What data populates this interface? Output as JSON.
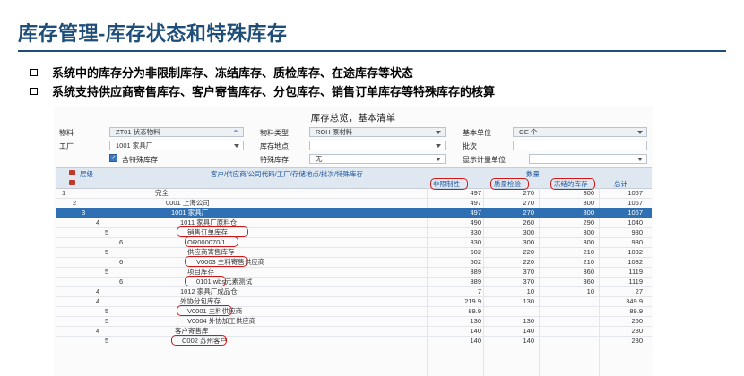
{
  "slide": {
    "title": "库存管理-库存状态和特殊库存",
    "bullets": [
      "系统中的库存分为非限制库存、冻结库存、质检库存、在途库存等状态",
      "系统支持供应商寄售库存、客户寄售库存、分包库存、销售订单库存等特殊库存的核算"
    ]
  },
  "screen": {
    "title": "库存总览，基本清单",
    "fields": {
      "material_label": "物料",
      "material_value": "ZT01 状态物料",
      "material_type_label": "物料类型",
      "material_type_value": "ROH 原材料",
      "base_unit_label": "基本单位",
      "base_unit_value": "GE 个",
      "plant_label": "工厂",
      "plant_value": "1001 家具厂",
      "storage_loc_label": "库存地点",
      "batch_label": "批次",
      "special_stock_checkbox_label": "含特殊库存",
      "special_stock_label": "特殊库存",
      "special_stock_value": "无",
      "display_unit_label": "显示计量单位"
    },
    "grid": {
      "header_left": "层级",
      "header_desc": "客户/供应商/公司代码/工厂/存储地点/批次/特殊库存",
      "header_qty": "数量",
      "columns": [
        "非限制性",
        "质量检验",
        "冻结的库存",
        "总计"
      ],
      "rows": [
        {
          "node": "1",
          "desc": "完全",
          "v": [
            "497",
            "270",
            "300",
            "1067"
          ]
        },
        {
          "node": "2",
          "desc": "0001 上海公司",
          "v": [
            "497",
            "270",
            "300",
            "1067"
          ]
        },
        {
          "node": "3",
          "desc": "1001 家具厂",
          "v": [
            "497",
            "270",
            "300",
            "1067"
          ]
        },
        {
          "node": "4",
          "desc": "1011 家具厂原料仓",
          "v": [
            "490",
            "260",
            "290",
            "1040"
          ]
        },
        {
          "node": "5",
          "desc": "销售订单库存",
          "v": [
            "330",
            "300",
            "300",
            "930"
          ]
        },
        {
          "node": "6",
          "desc": "OR000070/1",
          "v": [
            "330",
            "300",
            "300",
            "930"
          ]
        },
        {
          "node": "5",
          "desc": "供应商寄售库存",
          "v": [
            "602",
            "220",
            "210",
            "1032"
          ]
        },
        {
          "node": "6",
          "desc": "V0003 主料寄售供应商",
          "v": [
            "602",
            "220",
            "210",
            "1032"
          ]
        },
        {
          "node": "5",
          "desc": "项目库存",
          "v": [
            "389",
            "370",
            "360",
            "1119"
          ]
        },
        {
          "node": "6",
          "desc": "0101 wbs元素测试",
          "v": [
            "389",
            "370",
            "360",
            "1119"
          ]
        },
        {
          "node": "4",
          "desc": "1012 家具厂成品仓",
          "v": [
            "7",
            "10",
            "10",
            "27"
          ]
        },
        {
          "node": "4",
          "desc": "外协分包库存",
          "v": [
            "219.9",
            "130",
            "",
            "349.9"
          ]
        },
        {
          "node": "5",
          "desc": "V0001 主料供应商",
          "v": [
            "89.9",
            "",
            "",
            "89.9"
          ]
        },
        {
          "node": "5",
          "desc": "V0004 外协加工供应商",
          "v": [
            "130",
            "130",
            "",
            "260"
          ]
        },
        {
          "node": "4",
          "desc": "客户寄售库",
          "v": [
            "140",
            "140",
            "",
            "280"
          ]
        },
        {
          "node": "5",
          "desc": "C002 苏州客户",
          "v": [
            "140",
            "140",
            "",
            "280"
          ]
        }
      ]
    }
  }
}
